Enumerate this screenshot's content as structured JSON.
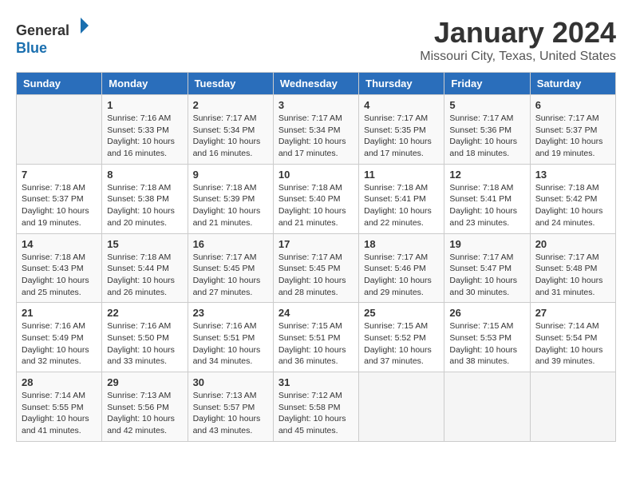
{
  "logo": {
    "general": "General",
    "blue": "Blue"
  },
  "title": "January 2024",
  "subtitle": "Missouri City, Texas, United States",
  "days_of_week": [
    "Sunday",
    "Monday",
    "Tuesday",
    "Wednesday",
    "Thursday",
    "Friday",
    "Saturday"
  ],
  "weeks": [
    [
      {
        "day": "",
        "info": ""
      },
      {
        "day": "1",
        "info": "Sunrise: 7:16 AM\nSunset: 5:33 PM\nDaylight: 10 hours\nand 16 minutes."
      },
      {
        "day": "2",
        "info": "Sunrise: 7:17 AM\nSunset: 5:34 PM\nDaylight: 10 hours\nand 16 minutes."
      },
      {
        "day": "3",
        "info": "Sunrise: 7:17 AM\nSunset: 5:34 PM\nDaylight: 10 hours\nand 17 minutes."
      },
      {
        "day": "4",
        "info": "Sunrise: 7:17 AM\nSunset: 5:35 PM\nDaylight: 10 hours\nand 17 minutes."
      },
      {
        "day": "5",
        "info": "Sunrise: 7:17 AM\nSunset: 5:36 PM\nDaylight: 10 hours\nand 18 minutes."
      },
      {
        "day": "6",
        "info": "Sunrise: 7:17 AM\nSunset: 5:37 PM\nDaylight: 10 hours\nand 19 minutes."
      }
    ],
    [
      {
        "day": "7",
        "info": "Sunrise: 7:18 AM\nSunset: 5:37 PM\nDaylight: 10 hours\nand 19 minutes."
      },
      {
        "day": "8",
        "info": "Sunrise: 7:18 AM\nSunset: 5:38 PM\nDaylight: 10 hours\nand 20 minutes."
      },
      {
        "day": "9",
        "info": "Sunrise: 7:18 AM\nSunset: 5:39 PM\nDaylight: 10 hours\nand 21 minutes."
      },
      {
        "day": "10",
        "info": "Sunrise: 7:18 AM\nSunset: 5:40 PM\nDaylight: 10 hours\nand 21 minutes."
      },
      {
        "day": "11",
        "info": "Sunrise: 7:18 AM\nSunset: 5:41 PM\nDaylight: 10 hours\nand 22 minutes."
      },
      {
        "day": "12",
        "info": "Sunrise: 7:18 AM\nSunset: 5:41 PM\nDaylight: 10 hours\nand 23 minutes."
      },
      {
        "day": "13",
        "info": "Sunrise: 7:18 AM\nSunset: 5:42 PM\nDaylight: 10 hours\nand 24 minutes."
      }
    ],
    [
      {
        "day": "14",
        "info": "Sunrise: 7:18 AM\nSunset: 5:43 PM\nDaylight: 10 hours\nand 25 minutes."
      },
      {
        "day": "15",
        "info": "Sunrise: 7:18 AM\nSunset: 5:44 PM\nDaylight: 10 hours\nand 26 minutes."
      },
      {
        "day": "16",
        "info": "Sunrise: 7:17 AM\nSunset: 5:45 PM\nDaylight: 10 hours\nand 27 minutes."
      },
      {
        "day": "17",
        "info": "Sunrise: 7:17 AM\nSunset: 5:45 PM\nDaylight: 10 hours\nand 28 minutes."
      },
      {
        "day": "18",
        "info": "Sunrise: 7:17 AM\nSunset: 5:46 PM\nDaylight: 10 hours\nand 29 minutes."
      },
      {
        "day": "19",
        "info": "Sunrise: 7:17 AM\nSunset: 5:47 PM\nDaylight: 10 hours\nand 30 minutes."
      },
      {
        "day": "20",
        "info": "Sunrise: 7:17 AM\nSunset: 5:48 PM\nDaylight: 10 hours\nand 31 minutes."
      }
    ],
    [
      {
        "day": "21",
        "info": "Sunrise: 7:16 AM\nSunset: 5:49 PM\nDaylight: 10 hours\nand 32 minutes."
      },
      {
        "day": "22",
        "info": "Sunrise: 7:16 AM\nSunset: 5:50 PM\nDaylight: 10 hours\nand 33 minutes."
      },
      {
        "day": "23",
        "info": "Sunrise: 7:16 AM\nSunset: 5:51 PM\nDaylight: 10 hours\nand 34 minutes."
      },
      {
        "day": "24",
        "info": "Sunrise: 7:15 AM\nSunset: 5:51 PM\nDaylight: 10 hours\nand 36 minutes."
      },
      {
        "day": "25",
        "info": "Sunrise: 7:15 AM\nSunset: 5:52 PM\nDaylight: 10 hours\nand 37 minutes."
      },
      {
        "day": "26",
        "info": "Sunrise: 7:15 AM\nSunset: 5:53 PM\nDaylight: 10 hours\nand 38 minutes."
      },
      {
        "day": "27",
        "info": "Sunrise: 7:14 AM\nSunset: 5:54 PM\nDaylight: 10 hours\nand 39 minutes."
      }
    ],
    [
      {
        "day": "28",
        "info": "Sunrise: 7:14 AM\nSunset: 5:55 PM\nDaylight: 10 hours\nand 41 minutes."
      },
      {
        "day": "29",
        "info": "Sunrise: 7:13 AM\nSunset: 5:56 PM\nDaylight: 10 hours\nand 42 minutes."
      },
      {
        "day": "30",
        "info": "Sunrise: 7:13 AM\nSunset: 5:57 PM\nDaylight: 10 hours\nand 43 minutes."
      },
      {
        "day": "31",
        "info": "Sunrise: 7:12 AM\nSunset: 5:58 PM\nDaylight: 10 hours\nand 45 minutes."
      },
      {
        "day": "",
        "info": ""
      },
      {
        "day": "",
        "info": ""
      },
      {
        "day": "",
        "info": ""
      }
    ]
  ]
}
